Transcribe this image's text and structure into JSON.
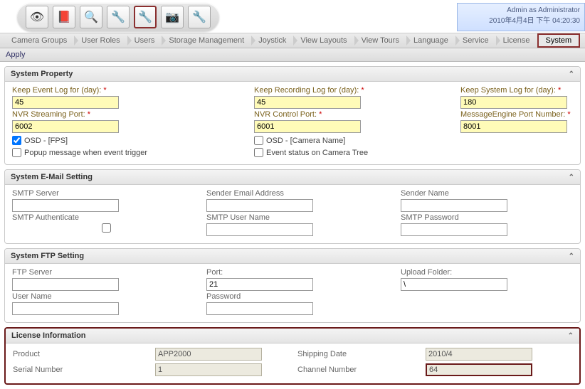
{
  "header": {
    "user_line": "Admin as Administrator",
    "time_line": "2010年4月4日 下午 04:20:30"
  },
  "toolbar": {
    "icons": [
      "eye",
      "door",
      "magnify-gear",
      "wrench",
      "wrench-selected",
      "cam-gear",
      "wrench2"
    ]
  },
  "tabs": {
    "items": [
      "Camera Groups",
      "User Roles",
      "Users",
      "Storage Management",
      "Joystick",
      "View Layouts",
      "View Tours",
      "Language",
      "Service",
      "License",
      "System"
    ],
    "active": "System"
  },
  "applybar": {
    "label": "Apply"
  },
  "sections": {
    "property": {
      "title": "System Property",
      "keep_event_label": "Keep Event Log for (day):",
      "keep_event_value": "45",
      "keep_recording_label": "Keep Recording Log for (day):",
      "keep_recording_value": "45",
      "keep_system_label": "Keep System Log for (day):",
      "keep_system_value": "180",
      "nvr_stream_label": "NVR Streaming Port:",
      "nvr_stream_value": "6002",
      "nvr_control_label": "NVR Control Port:",
      "nvr_control_value": "6001",
      "msg_engine_label": "MessageEngine Port Number:",
      "msg_engine_value": "8001",
      "osd_fps_label": "OSD - [FPS]",
      "osd_camera_label": "OSD - [Camera Name]",
      "popup_label": "Popup message when event trigger",
      "event_tree_label": "Event status on Camera Tree"
    },
    "email": {
      "title": "System E-Mail Setting",
      "smtp_server_label": "SMTP Server",
      "sender_email_label": "Sender Email Address",
      "sender_name_label": "Sender Name",
      "smtp_auth_label": "SMTP Authenticate",
      "smtp_user_label": "SMTP User Name",
      "smtp_pass_label": "SMTP Password"
    },
    "ftp": {
      "title": "System FTP Setting",
      "ftp_server_label": "FTP Server",
      "port_label": "Port:",
      "port_value": "21",
      "upload_label": "Upload Folder:",
      "upload_value": "\\",
      "user_label": "User Name",
      "pass_label": "Password"
    },
    "license": {
      "title": "License Information",
      "product_label": "Product",
      "product_value": "APP2000",
      "shipping_label": "Shipping Date",
      "shipping_value": "2010/4",
      "serial_label": "Serial Number",
      "serial_value": "1",
      "channel_label": "Channel Number",
      "channel_value": "64"
    }
  }
}
